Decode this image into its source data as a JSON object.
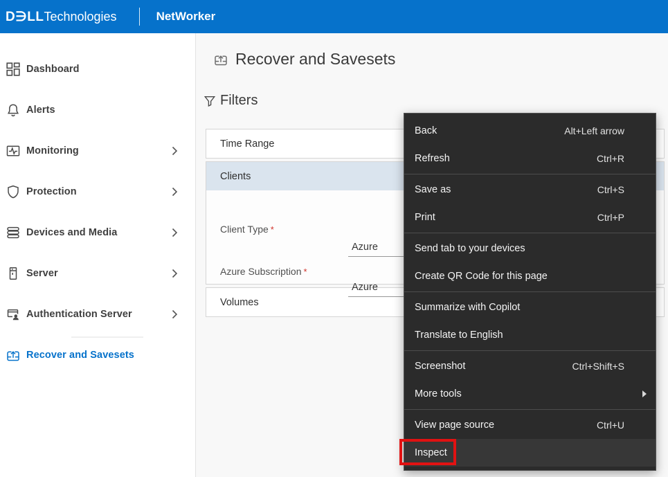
{
  "header": {
    "brand_dell": "D€LL",
    "brand_tech": "Technologies",
    "product": "NetWorker",
    "bg_color": "#0672CB"
  },
  "sidebar": {
    "active_color": "#0672CB",
    "items": [
      {
        "label": "Dashboard",
        "icon": "dashboard-icon",
        "has_submenu": false,
        "active": false
      },
      {
        "label": "Alerts",
        "icon": "bell-icon",
        "has_submenu": false,
        "active": false
      },
      {
        "label": "Monitoring",
        "icon": "monitoring-icon",
        "has_submenu": true,
        "active": false
      },
      {
        "label": "Protection",
        "icon": "shield-icon",
        "has_submenu": true,
        "active": false
      },
      {
        "label": "Devices and Media",
        "icon": "devices-icon",
        "has_submenu": true,
        "active": false
      },
      {
        "label": "Server",
        "icon": "server-icon",
        "has_submenu": true,
        "active": false
      },
      {
        "label": "Authentication Server",
        "icon": "auth-server-icon",
        "has_submenu": true,
        "active": false
      },
      {
        "label": "Recover and Savesets",
        "icon": "recover-icon",
        "has_submenu": false,
        "active": true
      }
    ]
  },
  "main": {
    "title": "Recover and Savesets",
    "filters_heading": "Filters",
    "panel": {
      "sections": [
        {
          "label": "Time Range",
          "expanded": false
        },
        {
          "label": "Clients",
          "expanded": true,
          "fields": [
            {
              "label": "Client Type",
              "required": true,
              "value": "Azure"
            },
            {
              "label": "Azure Subscription",
              "required": true,
              "value": "Azure"
            }
          ],
          "header_bg": "#dae4ee"
        },
        {
          "label": "Volumes",
          "expanded": false
        }
      ],
      "required_marker": "*",
      "required_color": "#d0342c"
    }
  },
  "context_menu": {
    "bg_color": "#2b2b2b",
    "items": [
      {
        "label": "Back",
        "shortcut": "Alt+Left arrow"
      },
      {
        "label": "Refresh",
        "shortcut": "Ctrl+R"
      },
      {
        "label": "Save as",
        "shortcut": "Ctrl+S"
      },
      {
        "label": "Print",
        "shortcut": "Ctrl+P"
      },
      {
        "label": "Send tab to your devices",
        "shortcut": ""
      },
      {
        "label": "Create QR Code for this page",
        "shortcut": ""
      },
      {
        "label": "Summarize with Copilot",
        "shortcut": ""
      },
      {
        "label": "Translate to English",
        "shortcut": ""
      },
      {
        "label": "Screenshot",
        "shortcut": "Ctrl+Shift+S"
      },
      {
        "label": "More tools",
        "shortcut": "",
        "has_submenu": true
      },
      {
        "label": "View page source",
        "shortcut": "Ctrl+U"
      },
      {
        "label": "Inspect",
        "shortcut": "",
        "annotated": true
      }
    ]
  },
  "annotation": {
    "shape": "red-box",
    "color": "#e11212",
    "target": "Inspect"
  }
}
